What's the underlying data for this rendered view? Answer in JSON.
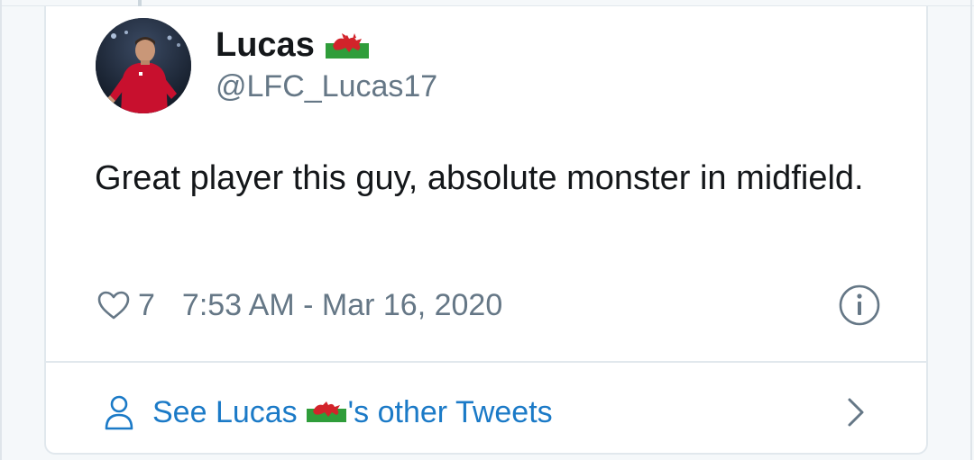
{
  "tweet": {
    "author_name": "Lucas",
    "author_handle": "@LFC_Lucas17",
    "flag_icon": "wales-flag-icon",
    "text": "Great player this guy, absolute monster in midfield.",
    "like_count": "7",
    "timestamp": "7:53 AM - Mar 16, 2020",
    "like_icon": "heart-outline-icon",
    "info_icon": "info-circle-icon"
  },
  "footer": {
    "link_prefix": "See Lucas",
    "link_suffix": "'s other Tweets",
    "person_icon": "person-outline-icon",
    "chevron_icon": "chevron-right-icon"
  },
  "colors": {
    "text_primary": "#14171a",
    "text_secondary": "#657786",
    "link": "#1b7ac7",
    "border": "#e1e8ed"
  }
}
